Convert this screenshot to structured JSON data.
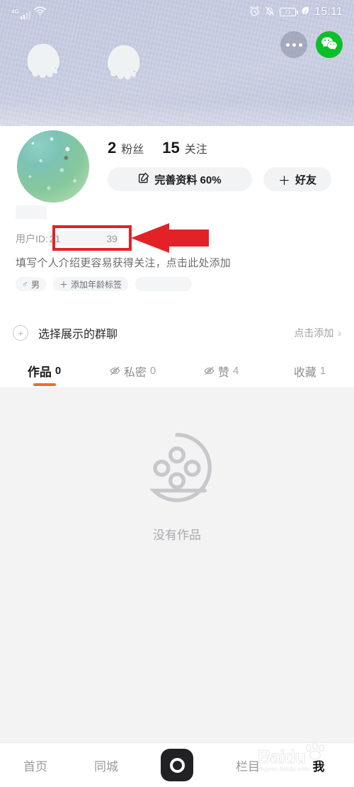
{
  "status_bar": {
    "network_type": "4G",
    "icons": [
      "signal-icon",
      "wifi-icon",
      "alarm-icon",
      "mute-icon",
      "battery-icon",
      "leaf-icon"
    ],
    "battery_level": "71",
    "time": "15:11"
  },
  "cover": {
    "more_button": "more-dots",
    "share_button": "wechat"
  },
  "profile": {
    "stats": [
      {
        "num": "2",
        "label": "粉丝"
      },
      {
        "num": "15",
        "label": "关注"
      }
    ],
    "buttons": {
      "complete_profile": "完善资料 60%",
      "add_friend": "好友",
      "add_friend_plus": "＋"
    },
    "nickname": "",
    "user_id_label": "用户ID:",
    "user_id_prefix": "21",
    "user_id_suffix": "39",
    "bio_prompt": "填写个人介绍更容易获得关注，点击此处添加",
    "tags": [
      {
        "icon": "♂",
        "label": "男"
      },
      {
        "icon": "＋",
        "label": "添加年龄标签"
      },
      {
        "icon": "",
        "label": ""
      }
    ]
  },
  "group_row": {
    "label": "选择展示的群聊",
    "action": "点击添加",
    "chevron": "›"
  },
  "tabs": [
    {
      "label": "作品",
      "count": "0",
      "active": true,
      "hidden_icon": false
    },
    {
      "label": "私密",
      "count": "0",
      "active": false,
      "hidden_icon": true
    },
    {
      "label": "赞",
      "count": "4",
      "active": false,
      "hidden_icon": true
    },
    {
      "label": "收藏",
      "count": "1",
      "active": false,
      "hidden_icon": false
    }
  ],
  "empty_state": {
    "icon": "film-reel-icon",
    "text": "没有作品"
  },
  "bottom_nav": [
    {
      "label": "首页",
      "active": false
    },
    {
      "label": "同城",
      "active": false
    },
    {
      "label": "",
      "active": false,
      "icon": "camera-record-icon"
    },
    {
      "label": "栏目",
      "active": false
    },
    {
      "label": "我",
      "active": true
    }
  ],
  "watermark": {
    "brand": "Baidu",
    "url": "jingyan.baidu.com"
  },
  "annotation": {
    "shape": "red-rectangle-and-arrow",
    "color": "#e32227",
    "target": "用户ID"
  },
  "colors": {
    "accent_orange": "#e8722c",
    "wechat_green": "#0bbf28",
    "annotation_red": "#e32227",
    "male_blue": "#3d9ad8"
  }
}
